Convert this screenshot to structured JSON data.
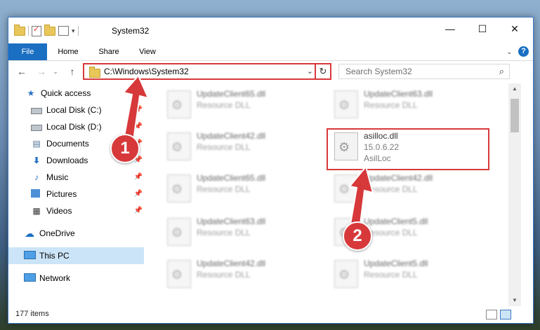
{
  "window": {
    "title": "System32",
    "min_glyph": "—",
    "max_glyph": "☐",
    "close_glyph": "✕"
  },
  "ribbon": {
    "tabs": [
      "File",
      "Home",
      "Share",
      "View"
    ],
    "help": "?"
  },
  "address": {
    "path": "C:\\Windows\\System32",
    "refresh_icon": "refresh-icon"
  },
  "search": {
    "placeholder": "Search System32"
  },
  "nav": {
    "items": [
      {
        "label": "Quick access",
        "icon": "star-icon"
      },
      {
        "label": "Local Disk (C:)",
        "icon": "drive-icon"
      },
      {
        "label": "Local Disk (D:)",
        "icon": "drive-icon"
      },
      {
        "label": "Documents",
        "icon": "documents-icon"
      },
      {
        "label": "Downloads",
        "icon": "downloads-icon"
      },
      {
        "label": "Music",
        "icon": "music-icon"
      },
      {
        "label": "Pictures",
        "icon": "pictures-icon"
      },
      {
        "label": "Videos",
        "icon": "videos-icon"
      },
      {
        "label": "OneDrive",
        "icon": "onedrive-icon"
      },
      {
        "label": "This PC",
        "icon": "computer-icon"
      },
      {
        "label": "Network",
        "icon": "network-icon"
      }
    ]
  },
  "files": [
    {
      "name": "UpdateClient65.dll",
      "type": "Resource DLL"
    },
    {
      "name": "UpdateClient63.dll",
      "type": "Resource DLL"
    },
    {
      "name": "UpdateClient42.dll",
      "type": "Resource DLL"
    },
    {
      "name": "asilloc.dll",
      "version": "15.0.6.22",
      "type": "AsilLoc"
    },
    {
      "name": "UpdateClient65.dll",
      "type": "Resource DLL"
    },
    {
      "name": "UpdateClient42.dll",
      "type": "Resource DLL"
    },
    {
      "name": "UpdateClient63.dll",
      "type": "Resource DLL"
    },
    {
      "name": "UpdateClient5.dll",
      "type": "Resource DLL"
    },
    {
      "name": "UpdateClient42.dll",
      "type": "Resource DLL"
    },
    {
      "name": "UpdateClient5.dll",
      "type": "Resource DLL"
    }
  ],
  "status": {
    "count": "177 items"
  },
  "annotations": {
    "step1": "1",
    "step2": "2"
  },
  "colors": {
    "accent": "#1a6fc2",
    "highlight": "#d7393b",
    "selected": "#cce4f7"
  }
}
